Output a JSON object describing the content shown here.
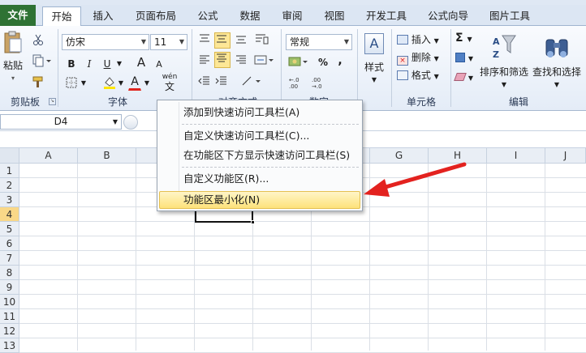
{
  "tabs": [
    {
      "label": "文件",
      "active": false
    },
    {
      "label": "开始",
      "active": true
    },
    {
      "label": "插入",
      "active": false
    },
    {
      "label": "页面布局",
      "active": false
    },
    {
      "label": "公式",
      "active": false
    },
    {
      "label": "数据",
      "active": false
    },
    {
      "label": "审阅",
      "active": false
    },
    {
      "label": "视图",
      "active": false
    },
    {
      "label": "开发工具",
      "active": false
    },
    {
      "label": "公式向导",
      "active": false
    },
    {
      "label": "图片工具",
      "active": false
    }
  ],
  "clipboard": {
    "paste_label": "粘贴",
    "group_label": "剪贴板"
  },
  "font": {
    "name": "仿宋",
    "size": "11",
    "group_label": "字体",
    "bold": "B",
    "italic": "I",
    "underline": "U",
    "grow": "A",
    "shrink": "A",
    "fill_letter": "A",
    "wen": "wén",
    "wen_char": "文"
  },
  "alignment": {
    "group_label": "对齐方式"
  },
  "number": {
    "format": "常规",
    "percent": "%",
    "comma": ",",
    "group_label": "数字"
  },
  "styles": {
    "label": "样式",
    "letter": "A"
  },
  "cells": {
    "insert": "插入",
    "delete": "删除",
    "format": "格式",
    "group_label": "单元格"
  },
  "editing": {
    "sigma": "Σ",
    "sort_label": "排序和筛选",
    "find_label": "查找和选择",
    "group_label": "编辑"
  },
  "formula_bar": {
    "name_box": "D4"
  },
  "sheet": {
    "columns": [
      "A",
      "B",
      "C",
      "D",
      "E",
      "F",
      "G",
      "H",
      "I",
      "J"
    ],
    "rows": [
      "1",
      "2",
      "3",
      "4",
      "5",
      "6",
      "7",
      "8",
      "9",
      "10",
      "11",
      "12",
      "13"
    ],
    "active_cell": "D4"
  },
  "context_menu": {
    "items": [
      "添加到快速访问工具栏(A)",
      "自定义快速访问工具栏(C)...",
      "在功能区下方显示快速访问工具栏(S)",
      "自定义功能区(R)...",
      "功能区最小化(N)"
    ],
    "highlighted_index": 4
  },
  "annotation": {
    "arrow_color": "#e3221f"
  },
  "colors": {
    "file_tab": "#2e7234",
    "highlight": "#fde27a",
    "arrow": "#e3221f"
  }
}
